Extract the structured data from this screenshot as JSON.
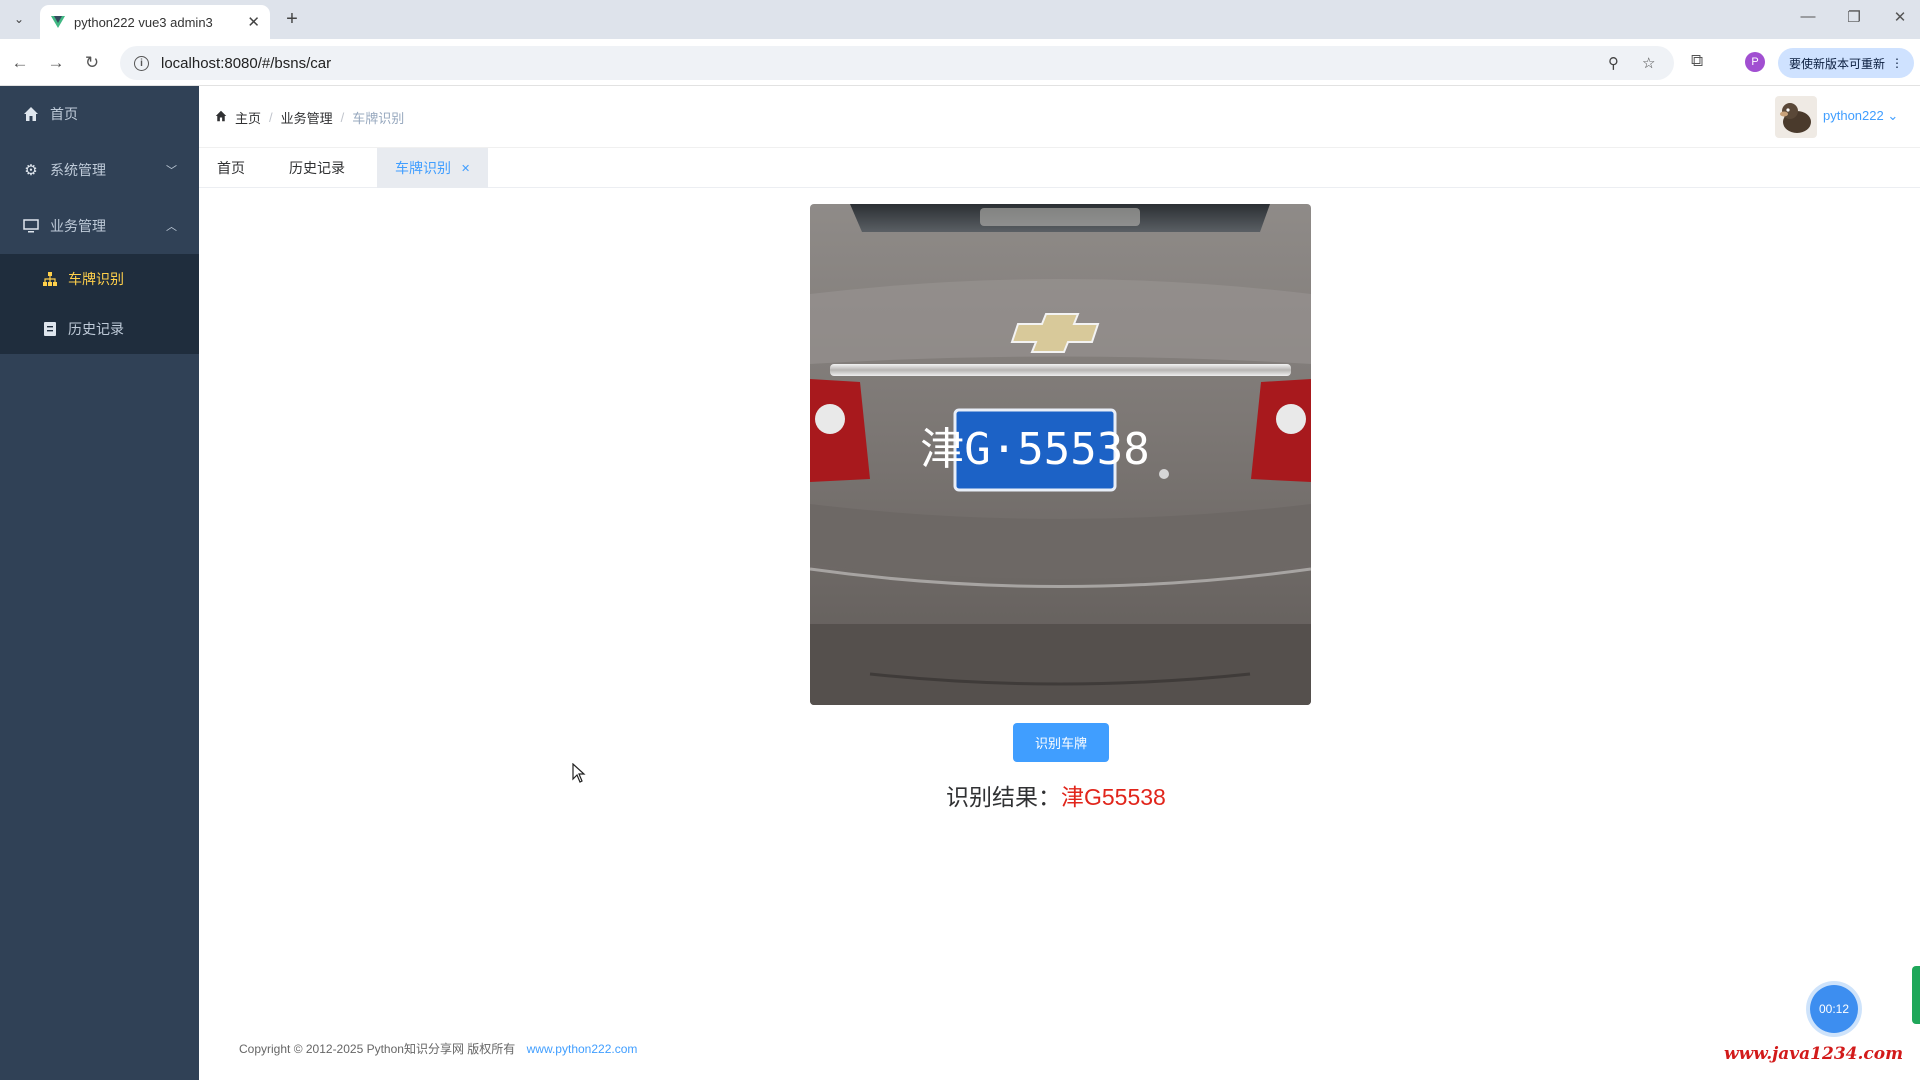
{
  "browser": {
    "tab_title": "python222 vue3 admin3",
    "url": "localhost:8080/#/bsns/car",
    "update_label": "要使新版本可重新"
  },
  "sidebar": {
    "items": [
      {
        "label": "首页",
        "icon": "home-icon"
      },
      {
        "label": "系统管理",
        "icon": "gear-icon"
      },
      {
        "label": "业务管理",
        "icon": "monitor-icon"
      }
    ],
    "subitems": [
      {
        "label": "车牌识别",
        "icon": "sitemap-icon"
      },
      {
        "label": "历史记录",
        "icon": "document-icon"
      }
    ]
  },
  "header": {
    "breadcrumb": [
      "主页",
      "业务管理",
      "车牌识别"
    ],
    "username": "python222"
  },
  "tags": [
    {
      "label": "首页"
    },
    {
      "label": "历史记录"
    },
    {
      "label": "车牌识别"
    }
  ],
  "main": {
    "car_plate_in_photo": "津G·55538",
    "recognize_button": "识别车牌",
    "result_label": "识别结果：",
    "result_value": "津G55538"
  },
  "footer": {
    "copyright": "Copyright © 2012-2025 Python知识分享网 版权所有",
    "link": "www.python222.com"
  },
  "overlay": {
    "timer": "00:12",
    "watermark": "www.java1234.com"
  },
  "colors": {
    "sidebar_bg": "#304156",
    "sidebar_active": "#ffd04b",
    "accent": "#409eff",
    "result_red": "#e1251b"
  }
}
